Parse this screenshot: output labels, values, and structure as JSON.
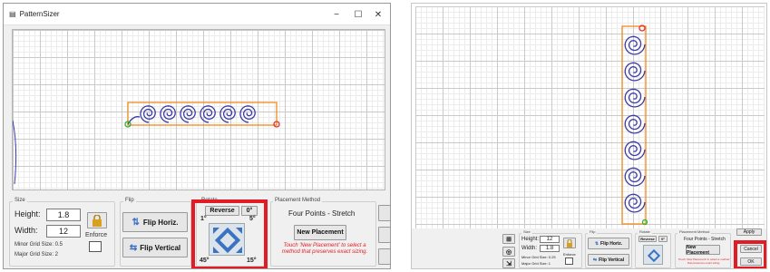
{
  "left": {
    "window_title": "PatternSizer",
    "controls": {
      "minimize": "−",
      "maximize": "☐",
      "close": "✕"
    },
    "size_group": {
      "title": "Size",
      "height_label": "Height:",
      "height_value": "1.8",
      "width_label": "Width:",
      "width_value": "12",
      "enforce_label": "Enforce",
      "minor_grid": "Minor Grid Size: 0.5",
      "major_grid": "Major Grid Size: 2"
    },
    "flip_group": {
      "title": "Flip",
      "flip_horiz": "Flip Horiz.",
      "flip_vertical": "Flip Vertical"
    },
    "rotate_group": {
      "title": "Rotate",
      "reverse": "Reverse",
      "angle_0": "0°",
      "angle_1": "1°",
      "angle_5": "5°",
      "angle_45": "45°",
      "angle_15": "15°"
    },
    "placement_group": {
      "title": "Placement Method",
      "method": "Four Points - Stretch",
      "new_placement": "New Placement",
      "note": "Touch 'New Placement' to select a method that preserves exact sizing."
    }
  },
  "right": {
    "size_group": {
      "title": "Size",
      "height_label": "Height:",
      "height_value": "12",
      "width_label": "Width:",
      "width_value": "1.8",
      "enforce_label": "Enforce",
      "minor_grid": "Minor Grid Size: 0.25",
      "major_grid": "Major Grid Size: 1"
    },
    "flip_group": {
      "title": "Flip",
      "flip_horiz": "Flip Horiz.",
      "flip_vertical": "Flip Vertical"
    },
    "rotate_group": {
      "title": "Rotate",
      "reverse": "Reverse",
      "angle_0": "0°"
    },
    "placement_group": {
      "title": "Placement Method",
      "method": "Four Points - Stretch",
      "new_placement": "New Placement",
      "note": "Touch 'New Placement' to select a method that preserves exact sizing."
    },
    "buttons": {
      "apply": "Apply",
      "cancel": "Cancel",
      "ok": "OK"
    }
  },
  "colors": {
    "highlight": "#e11c24",
    "spiral": "#3b3ba6",
    "bounding_box": "#f08a1c",
    "note_red": "#e0202a"
  }
}
